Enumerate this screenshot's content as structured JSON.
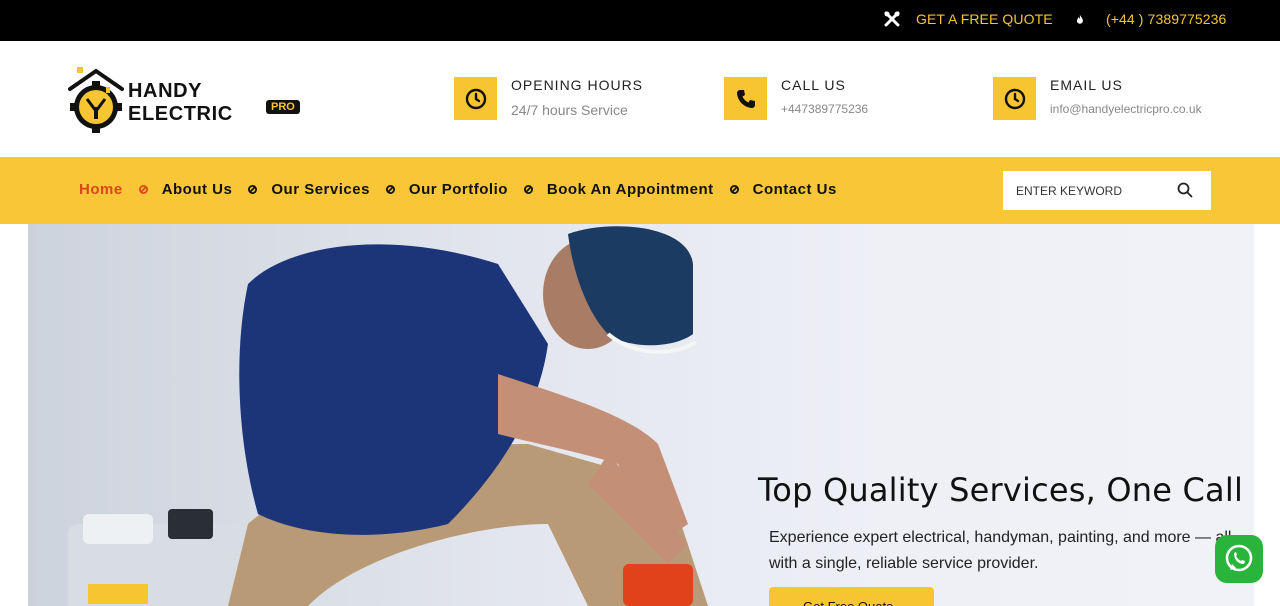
{
  "topbar": {
    "quote_label": "GET A FREE QUOTE",
    "phone_label": "(+44 ) 7389775236"
  },
  "logo": {
    "brand": "HANDY ELECTRIC",
    "badge": "PRO"
  },
  "info": [
    {
      "title": "OPENING HOURS",
      "value": "24/7 hours Service",
      "icon": "clock-icon"
    },
    {
      "title": "CALL US",
      "value": "+447389775236",
      "icon": "phone-icon"
    },
    {
      "title": "EMAIL US",
      "value": "info@handyelectricpro.co.uk",
      "icon": "clock-icon"
    }
  ],
  "nav": {
    "items": [
      {
        "label": "Home",
        "active": true
      },
      {
        "label": "About Us"
      },
      {
        "label": "Our Services"
      },
      {
        "label": "Our Portfolio"
      },
      {
        "label": "Book An Appointment"
      },
      {
        "label": "Contact Us"
      }
    ],
    "search_placeholder": "ENTER KEYWORD"
  },
  "hero": {
    "title": "Top Quality Services, One Call",
    "description": "Experience expert electrical, handyman, painting, and more — all with a single, reliable service provider.",
    "button_label": "Get Free Quote"
  },
  "colors": {
    "accent": "#f9c637",
    "active_nav": "#e0441a",
    "topbar": "#000000",
    "whatsapp": "#29b43c"
  }
}
